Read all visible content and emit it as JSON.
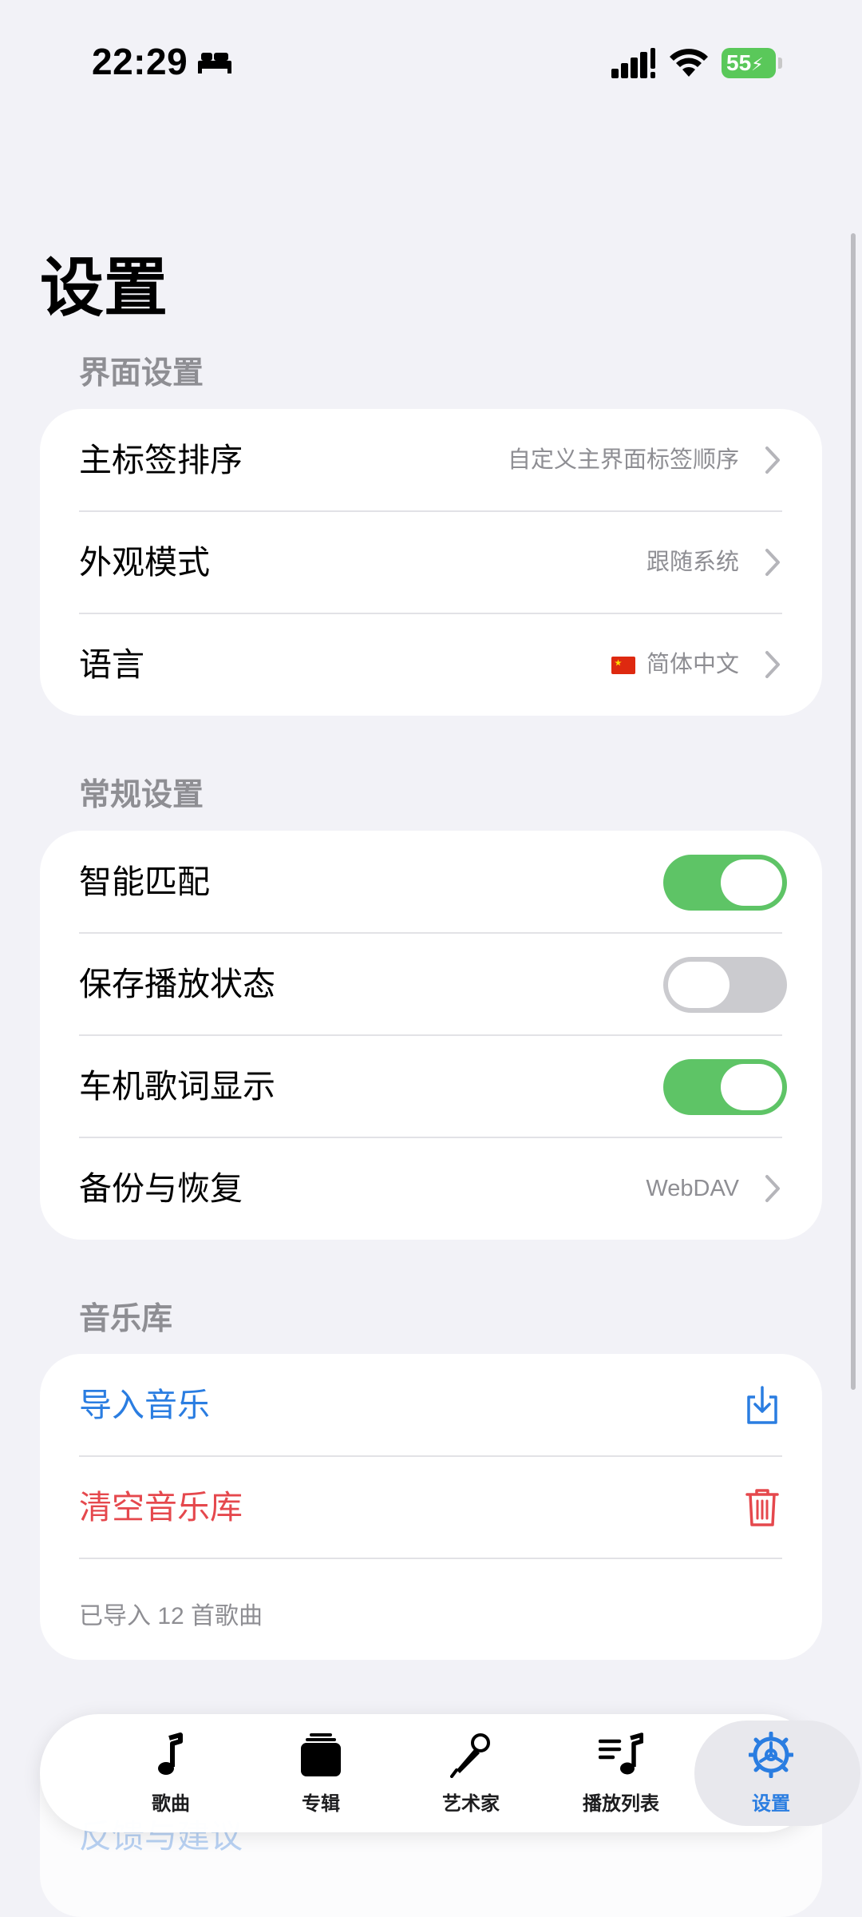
{
  "status_bar": {
    "time": "22:29",
    "battery_level": "55"
  },
  "page": {
    "title": "设置"
  },
  "sections": {
    "interface": {
      "header": "界面设置",
      "rows": [
        {
          "label": "主标签排序",
          "value": "自定义主界面标签顺序"
        },
        {
          "label": "外观模式",
          "value": "跟随系统"
        },
        {
          "label": "语言",
          "value": "简体中文"
        }
      ]
    },
    "general": {
      "header": "常规设置",
      "rows": [
        {
          "label": "智能匹配",
          "toggle": true
        },
        {
          "label": "保存播放状态",
          "toggle": false
        },
        {
          "label": "车机歌词显示",
          "toggle": true
        },
        {
          "label": "备份与恢复",
          "value": "WebDAV"
        }
      ]
    },
    "library": {
      "header": "音乐库",
      "import_label": "导入音乐",
      "clear_label": "清空音乐库",
      "count_text": "已导入 12 首歌曲"
    }
  },
  "ghost_row": {
    "label": "反馈与建议"
  },
  "tabs": [
    {
      "label": "歌曲",
      "icon": "music-note-icon"
    },
    {
      "label": "专辑",
      "icon": "album-stack-icon"
    },
    {
      "label": "艺术家",
      "icon": "microphone-icon"
    },
    {
      "label": "播放列表",
      "icon": "playlist-icon"
    },
    {
      "label": "设置",
      "icon": "gear-icon",
      "active": true
    }
  ],
  "colors": {
    "accent": "#2a7de1",
    "destructive": "#e5484d",
    "toggle_on": "#5ec466",
    "toggle_off": "#cbcbcf",
    "background": "#f2f2f7"
  }
}
